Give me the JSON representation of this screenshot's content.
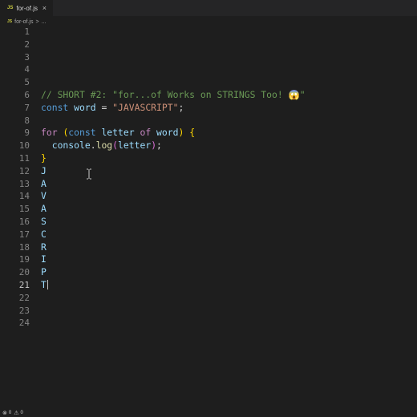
{
  "tab": {
    "icon": "JS",
    "name": "for-of.js",
    "close": "×"
  },
  "breadcrumb": {
    "icon": "JS",
    "file": "for-of.js",
    "separator": ">",
    "more": "..."
  },
  "gutter": {
    "active_line": 21,
    "lines": [
      1,
      2,
      3,
      4,
      5,
      6,
      7,
      8,
      9,
      10,
      11,
      12,
      13,
      14,
      15,
      16,
      17,
      18,
      19,
      20,
      21,
      22,
      23,
      24
    ]
  },
  "code": {
    "line6_comment": "// SHORT #2: \"for...of Works on STRINGS Too! 😱\"",
    "line7": {
      "kw": "const",
      "name": "word",
      "op": "=",
      "value": "\"JAVASCRIPT\"",
      "end": ";"
    },
    "line9": {
      "kw": "for",
      "open": "(",
      "decl": "const",
      "var": "letter",
      "of": "of",
      "iter": "word",
      "close": ")",
      "brace": "{"
    },
    "line10": {
      "obj": "console",
      "dot": ".",
      "fn": "log",
      "open": "(",
      "arg": "letter",
      "close": ")",
      "end": ";"
    },
    "line11": {
      "brace": "}"
    },
    "output": [
      "J",
      "A",
      "V",
      "A",
      "S",
      "C",
      "R",
      "I",
      "P",
      "T"
    ]
  },
  "statusbar": {
    "errors": "0",
    "warnings": "0"
  },
  "colors": {
    "background": "#1e1e1e",
    "comment": "#6a9955",
    "keyword": "#569cd6",
    "string": "#ce9178"
  }
}
